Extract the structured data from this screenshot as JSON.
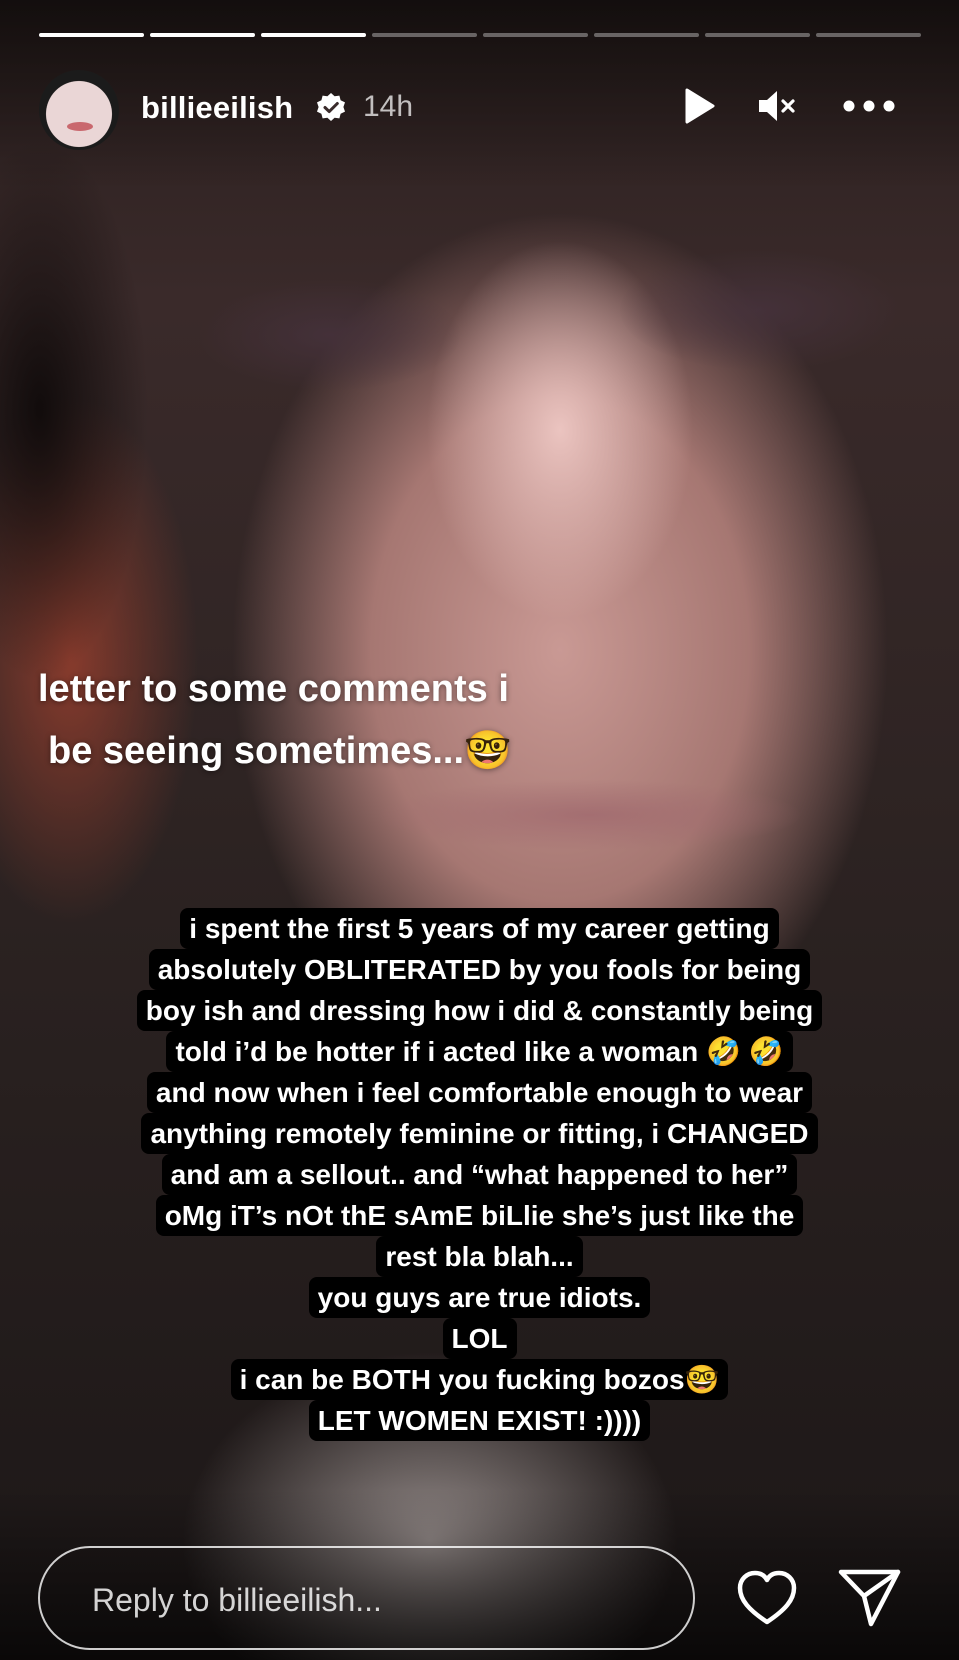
{
  "story": {
    "progress": {
      "total_segments": 8,
      "completed_segments": 3
    },
    "header": {
      "username": "billieeilish",
      "verified": true,
      "timestamp": "14h",
      "icons": [
        "avatar",
        "verified-badge-icon",
        "play-icon",
        "mute-icon",
        "more-icon"
      ]
    },
    "caption": {
      "line1": "letter to some comments i",
      "line2": "be seeing sometimes...🤓"
    },
    "message_lines": [
      "i spent the first 5 years of my career getting",
      "absolutely OBLITERATED by you fools for being",
      "boy ish and dressing how i did & constantly being",
      "told i’d be hotter if i acted like a woman 🤣 🤣",
      "and now when i feel comfortable enough to wear",
      "anything remotely feminine or fitting, i CHANGED",
      "and am a sellout.. and “what happened to her”",
      "oMg iT’s nOt thE sAmE biLlie she’s just like the",
      "rest bla blah...",
      "you guys are true idiots.",
      "LOL",
      "i can be BOTH you fucking bozos🤓",
      "LET WOMEN EXIST! :))))"
    ]
  },
  "reply": {
    "placeholder": "Reply to billieeilish...",
    "value": ""
  },
  "colors": {
    "text": "#ffffff",
    "text_bg": "#000000",
    "progress_inactive": "rgba(255,255,255,0.35)"
  }
}
